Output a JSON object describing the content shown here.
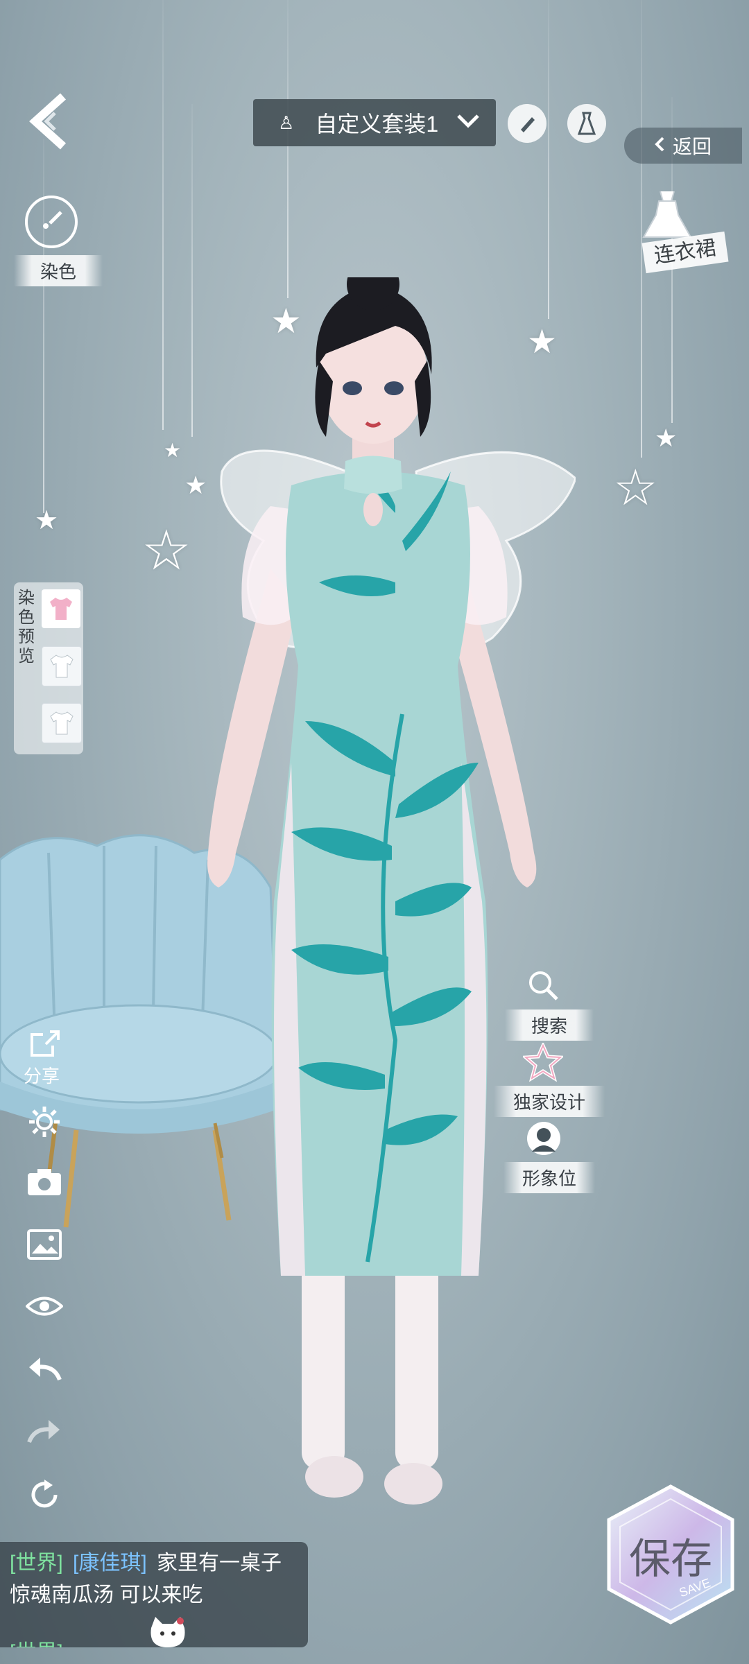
{
  "top_bar": {
    "outfit_name": "自定义套装1",
    "back_label": "返回"
  },
  "left_tools": {
    "dye_label": "染色",
    "dye_preview_label": "染色预览",
    "share_label": "分享"
  },
  "category": {
    "label": "连衣裙"
  },
  "right_actions": {
    "search_label": "搜索",
    "exclusive_label": "独家设计",
    "image_slot_label": "形象位"
  },
  "save": {
    "label": "保存",
    "sub_label": "SAVE"
  },
  "chat": {
    "channel": "[世界]",
    "user": "[康佳琪]",
    "message": "家里有一桌子惊魂南瓜汤 可以来吃",
    "next_channel_partial": "[世界]"
  },
  "colors": {
    "dress": "#a8d6d4",
    "leaf": "#27a4a8",
    "chair": "#a9cfe0",
    "chat_green": "#7fe3a0",
    "chat_blue": "#7cc3ff"
  }
}
